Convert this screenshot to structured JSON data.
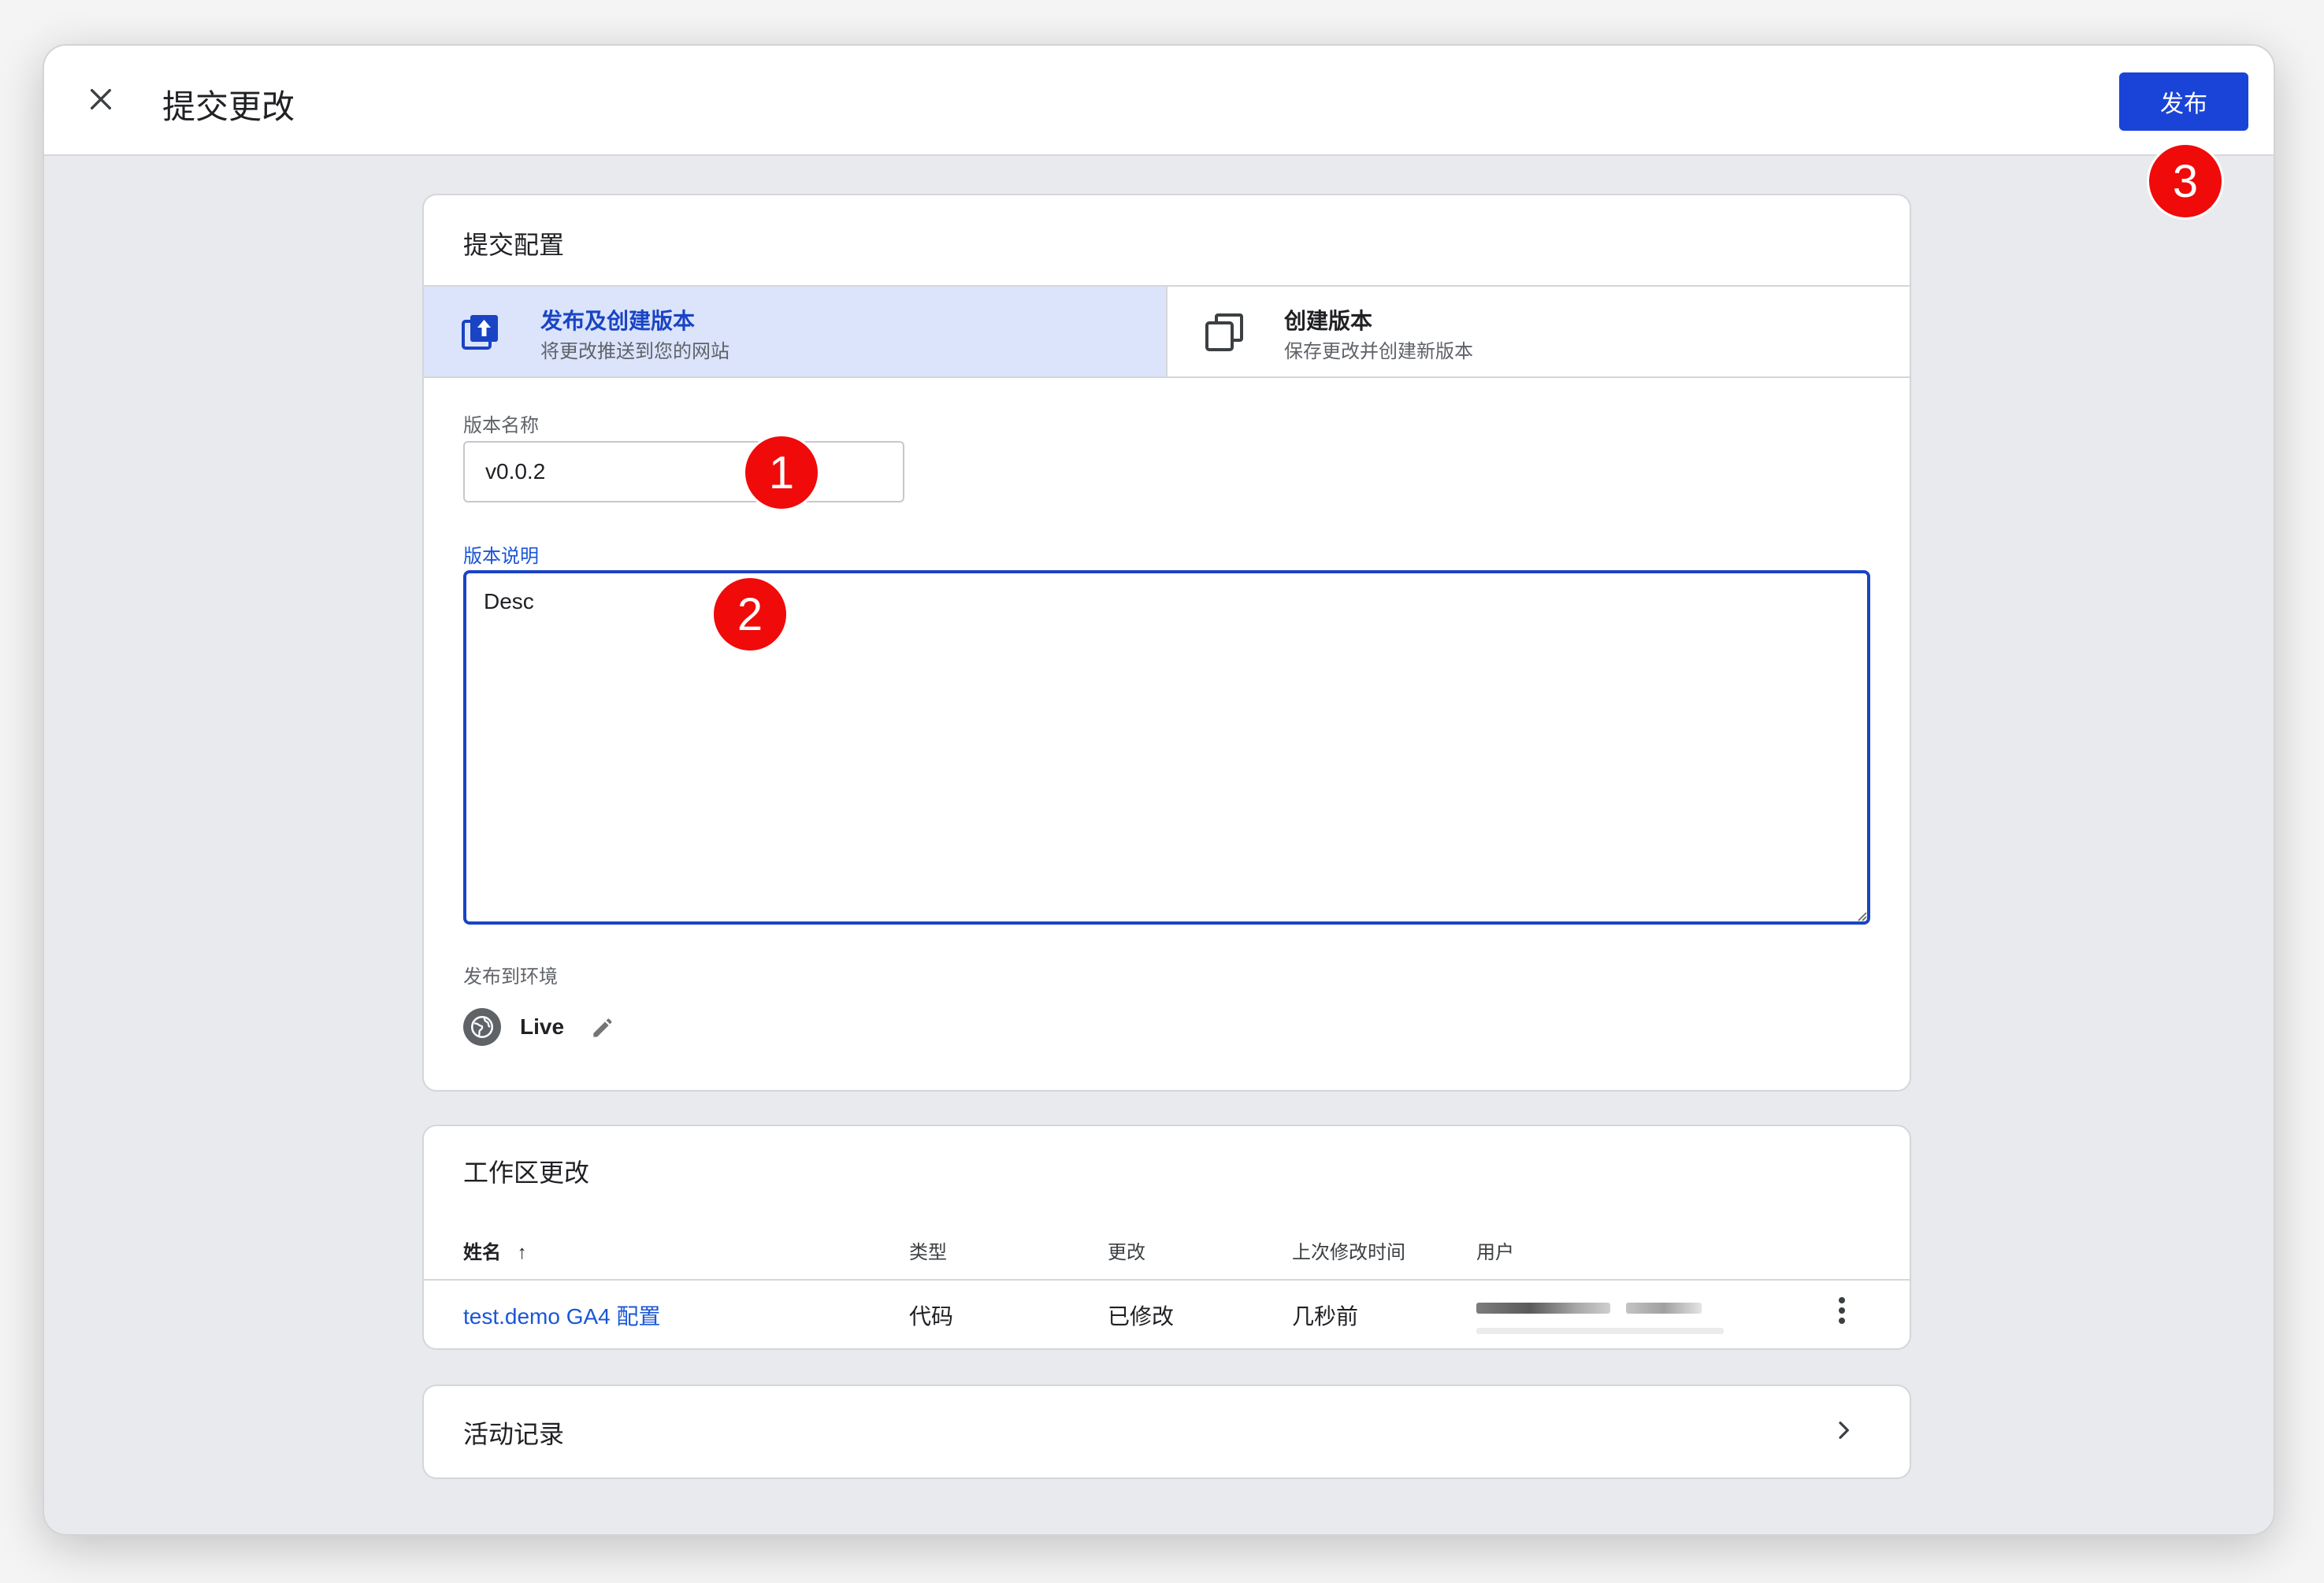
{
  "header": {
    "title": "提交更改",
    "publish_label": "发布"
  },
  "badges": [
    "1",
    "2",
    "3"
  ],
  "submit_config": {
    "title": "提交配置",
    "options": [
      {
        "title": "发布及创建版本",
        "subtitle": "将更改推送到您的网站",
        "selected": true
      },
      {
        "title": "创建版本",
        "subtitle": "保存更改并创建新版本",
        "selected": false
      }
    ],
    "version_name_label": "版本名称",
    "version_name_value": "v0.0.2",
    "version_desc_label": "版本说明",
    "version_desc_value": "Desc",
    "env_label": "发布到环境",
    "env_name": "Live"
  },
  "workspace": {
    "title": "工作区更改",
    "columns": [
      "姓名",
      "类型",
      "更改",
      "上次修改时间",
      "用户"
    ],
    "sort_indicator": "↑",
    "rows": [
      {
        "name": "test.demo GA4 配置",
        "type": "代码",
        "change": "已修改",
        "modified": "几秒前"
      }
    ]
  },
  "activity": {
    "title": "活动记录"
  },
  "colors": {
    "accent": "#1a44d8",
    "selected_bg": "#dbe4fb",
    "badge": "#f00a0a"
  }
}
